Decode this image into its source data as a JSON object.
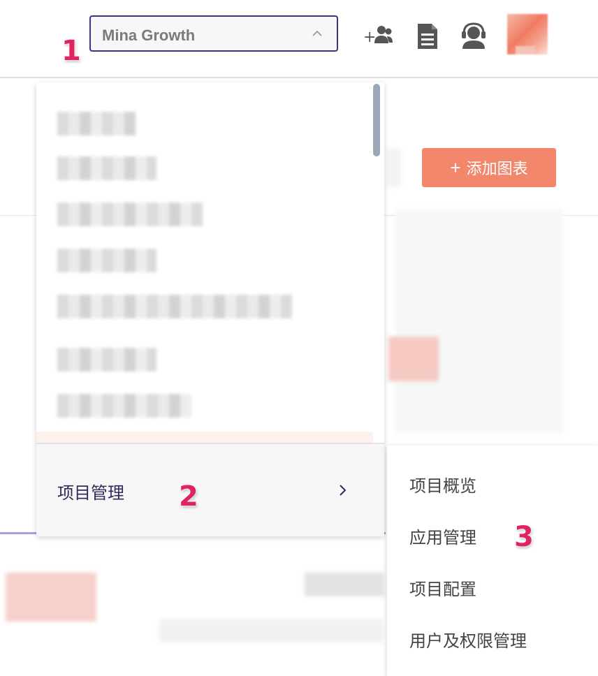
{
  "header": {
    "project_select": {
      "value": "Mina Growth",
      "icon": "chevron-up-icon"
    },
    "actions": [
      {
        "name": "add-member-icon"
      },
      {
        "name": "document-icon"
      },
      {
        "name": "support-headset-icon"
      }
    ],
    "avatar": "avatar"
  },
  "page": {
    "add_chart_button": {
      "plus": "+",
      "label": "添加图表"
    }
  },
  "dropdown": {
    "footer": {
      "label": "项目管理",
      "icon": "chevron-right-icon"
    }
  },
  "submenu": {
    "items": [
      "项目概览",
      "应用管理",
      "项目配置",
      "用户及权限管理"
    ]
  },
  "annotations": {
    "step1": "1",
    "step2": "2",
    "step3": "3"
  },
  "colors": {
    "accent_border": "#3b3580",
    "add_chart_bg": "#f2876c",
    "step_marker": "#e0245e"
  }
}
